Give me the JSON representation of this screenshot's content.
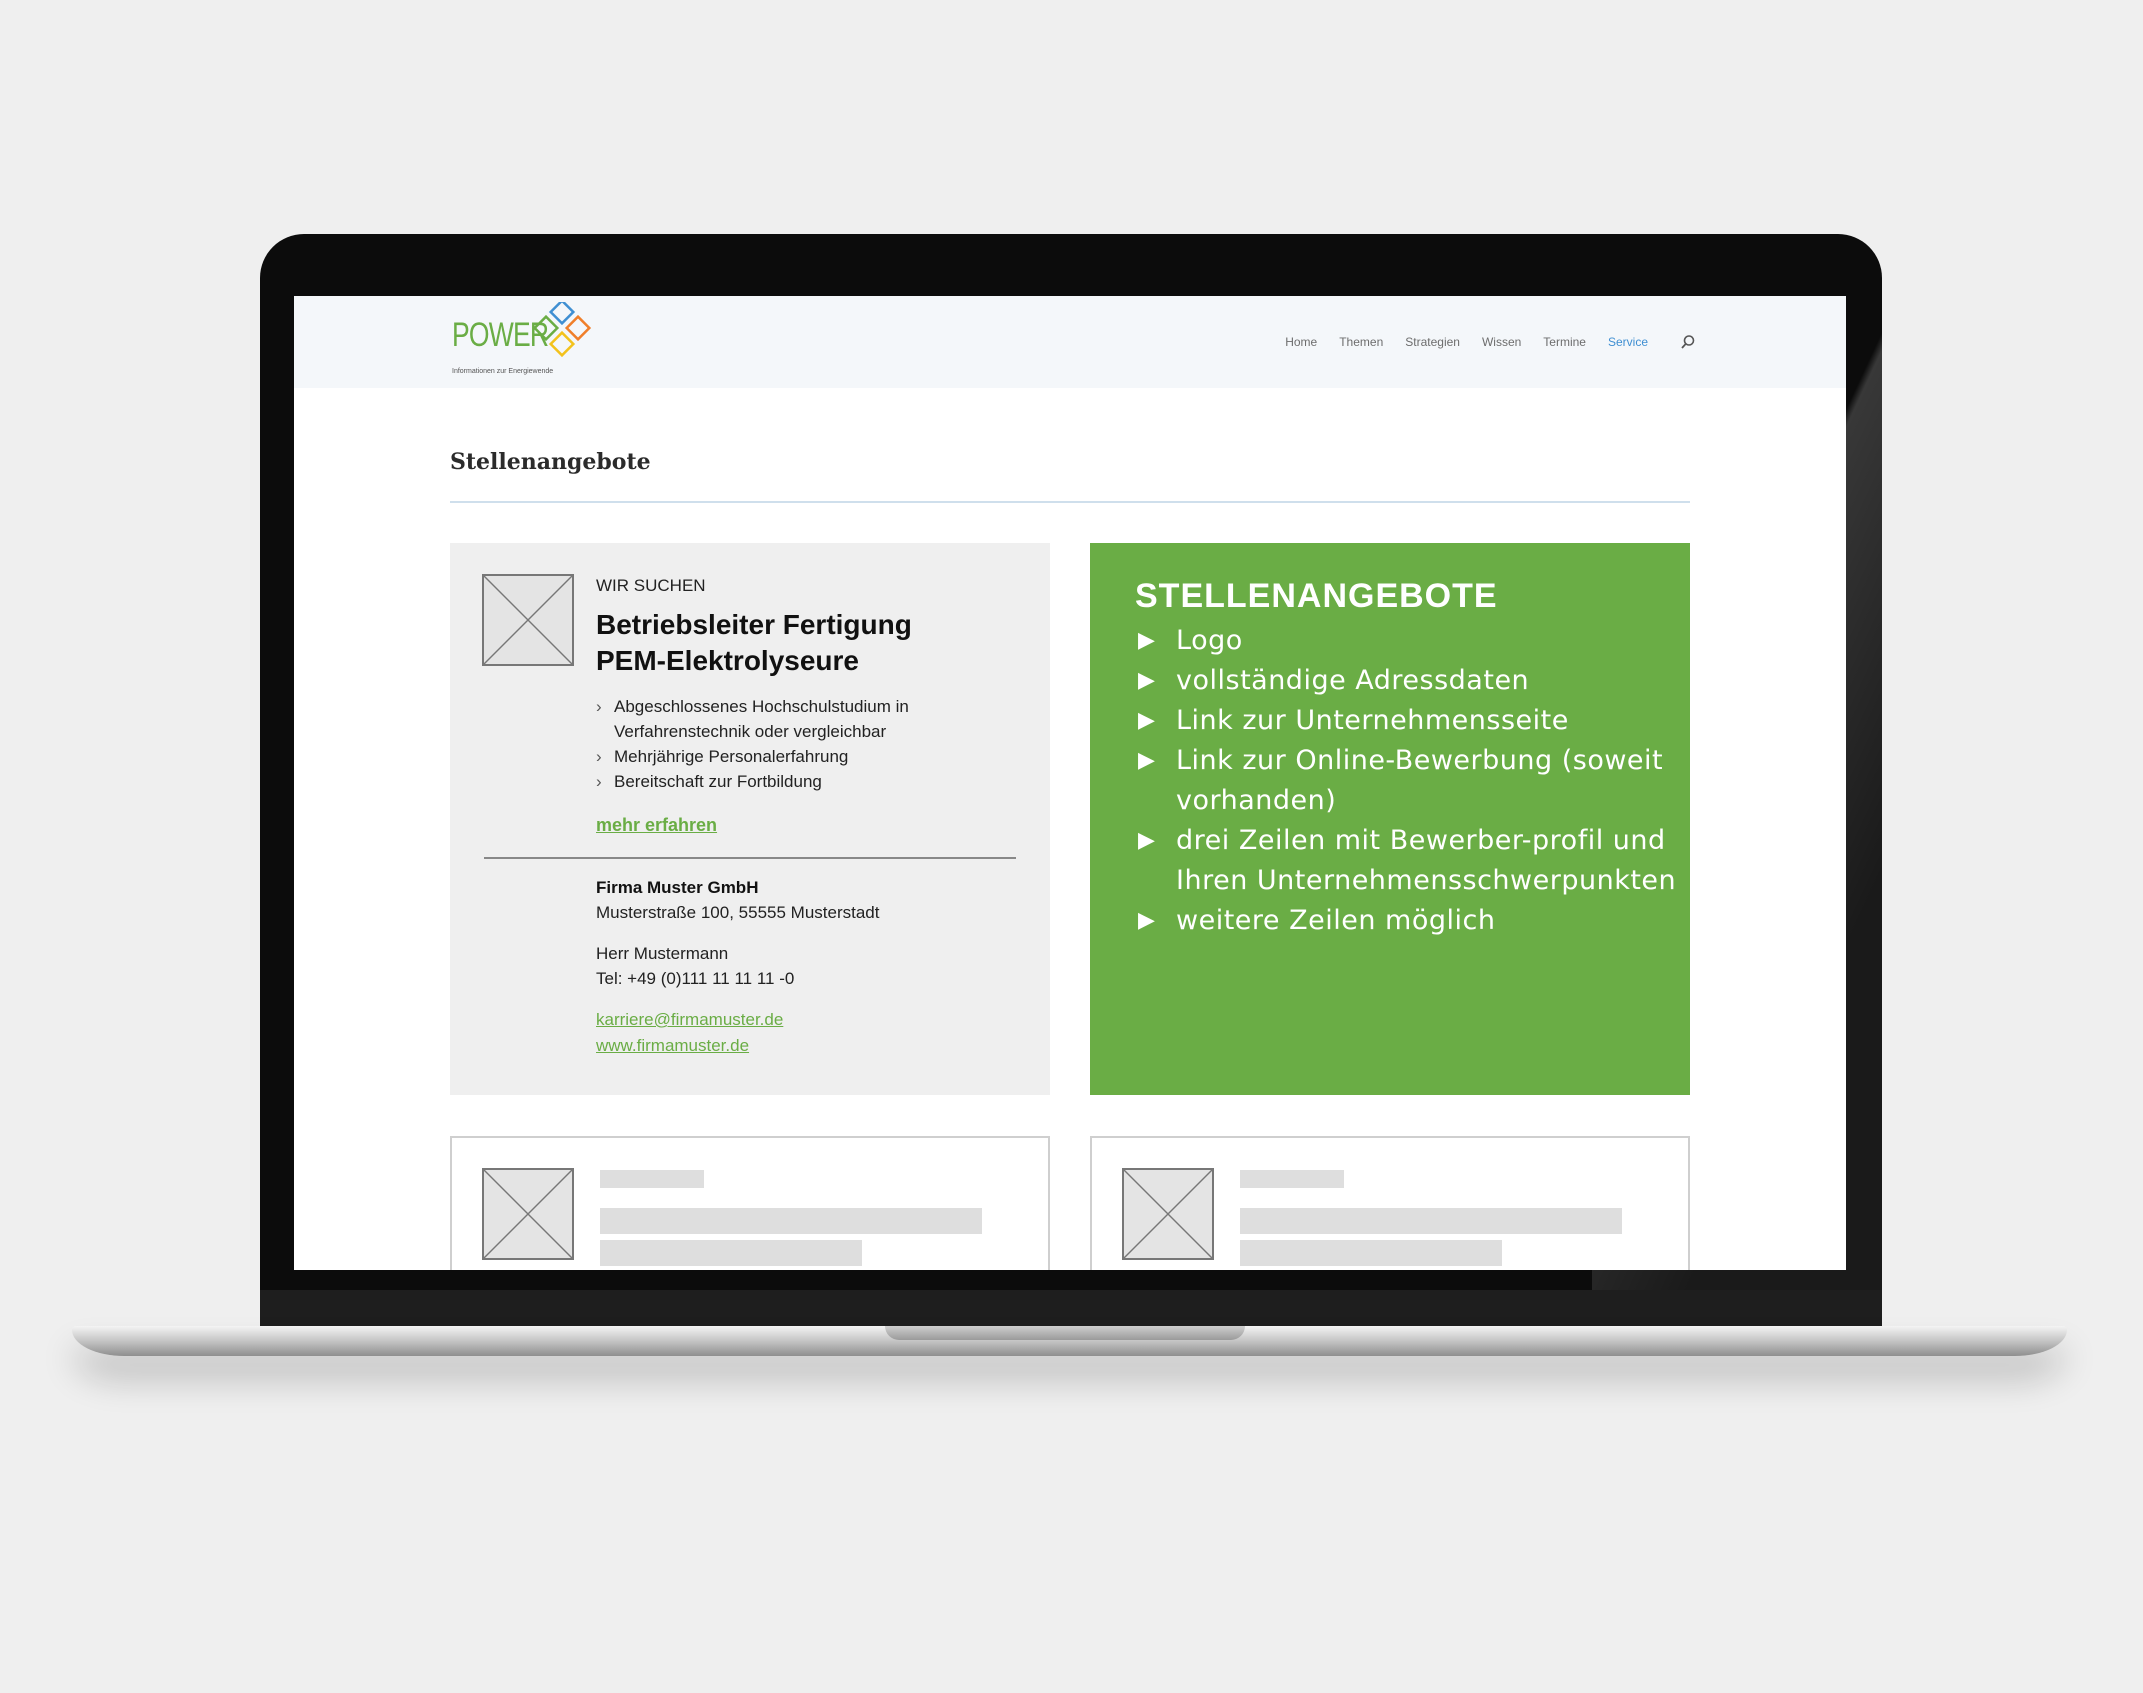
{
  "logo": {
    "text": "POWER",
    "tagline": "Informationen zur Energiewende",
    "colors": {
      "green": "#6aad45",
      "blue": "#3f8fd2",
      "orange": "#f07f2a",
      "yellow": "#f3c21c"
    }
  },
  "nav": {
    "items": [
      "Home",
      "Themen",
      "Strategien",
      "Wissen",
      "Termine",
      "Service"
    ],
    "active": "Service",
    "search_icon": "search-icon"
  },
  "page": {
    "title": "Stellenangebote"
  },
  "job": {
    "eyebrow": "WIR SUCHEN",
    "title_line1": "Betriebsleiter Fertigung",
    "title_line2": "PEM-Elektrolyseure",
    "requirements": [
      "Abgeschlossenes Hochschulstudium in Verfahrenstechnik oder vergleichbar",
      "Mehrjährige Personalerfahrung",
      "Bereitschaft zur Fortbildung"
    ],
    "more_link": "mehr erfahren",
    "company": "Firma Muster GmbH",
    "address": "Musterstraße 100, 55555 Musterstadt",
    "contact": "Herr Mustermann",
    "phone": "Tel: +49 (0)111 11 11 11 -0",
    "email": "karriere@firmamuster.de",
    "website": "www.firmamuster.de"
  },
  "info": {
    "title": "STELLENANGEBOTE",
    "items": [
      "Logo",
      "vollständige Adressdaten",
      "Link zur Unternehmensseite",
      "Link zur Online-Bewerbung (soweit vorhanden)",
      "drei Zeilen mit Bewerber-profil und Ihren Unternehmensschwerpunkten",
      "weitere Zeilen möglich"
    ],
    "color": "#6aad45"
  }
}
